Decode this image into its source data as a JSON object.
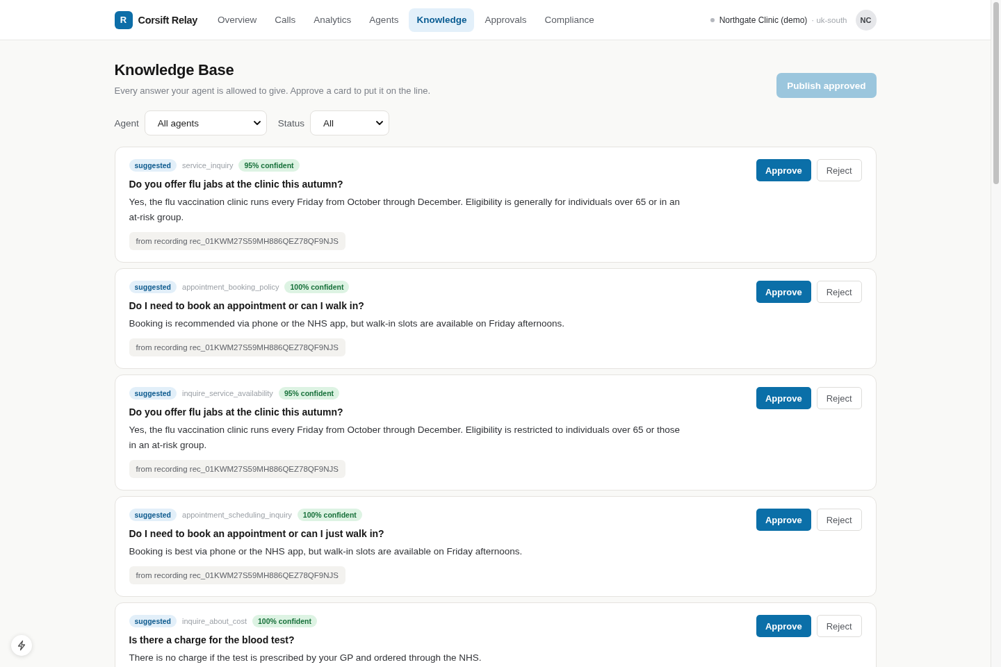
{
  "app": {
    "logo_letter": "R",
    "brand": "Corsift Relay"
  },
  "nav": [
    {
      "label": "Overview",
      "selected": false
    },
    {
      "label": "Calls",
      "selected": false
    },
    {
      "label": "Analytics",
      "selected": false
    },
    {
      "label": "Agents",
      "selected": false
    },
    {
      "label": "Knowledge",
      "selected": true
    },
    {
      "label": "Approvals",
      "selected": false
    },
    {
      "label": "Compliance",
      "selected": false
    }
  ],
  "account": {
    "workspace": "Northgate Clinic (demo)",
    "region": "· uk-south",
    "initials": "NC"
  },
  "page": {
    "title": "Knowledge Base",
    "subtitle": "Every answer your agent is allowed to give. Approve a card to put it on the line.",
    "publish_button": {
      "label": "Publish approved",
      "disabled": true
    }
  },
  "filters": [
    {
      "label": "Agent",
      "value": "All agents"
    },
    {
      "label": "Status",
      "value": "All"
    }
  ],
  "cards": [
    {
      "status": "suggested",
      "intent": "service_inquiry",
      "confidence": "95% confident",
      "question": "Do you offer flu jabs at the clinic this autumn?",
      "answer": "Yes, the flu vaccination clinic runs every Friday from October through December. Eligibility is generally for individuals over 65 or in an at-risk group.",
      "source": "from recording rec_01KWM27S59MH886QEZ78QF9NJS",
      "approve": "Approve",
      "reject": "Reject"
    },
    {
      "status": "suggested",
      "intent": "appointment_booking_policy",
      "confidence": "100% confident",
      "question": "Do I need to book an appointment or can I walk in?",
      "answer": "Booking is recommended via phone or the NHS app, but walk-in slots are available on Friday afternoons.",
      "source": "from recording rec_01KWM27S59MH886QEZ78QF9NJS",
      "approve": "Approve",
      "reject": "Reject"
    },
    {
      "status": "suggested",
      "intent": "inquire_service_availability",
      "confidence": "95% confident",
      "question": "Do you offer flu jabs at the clinic this autumn?",
      "answer": "Yes, the flu vaccination clinic runs every Friday from October through December. Eligibility is restricted to individuals over 65 or those in an at-risk group.",
      "source": "from recording rec_01KWM27S59MH886QEZ78QF9NJS",
      "approve": "Approve",
      "reject": "Reject"
    },
    {
      "status": "suggested",
      "intent": "appointment_scheduling_inquiry",
      "confidence": "100% confident",
      "question": "Do I need to book an appointment or can I just walk in?",
      "answer": "Booking is best via phone or the NHS app, but walk-in slots are available on Friday afternoons.",
      "source": "from recording rec_01KWM27S59MH886QEZ78QF9NJS",
      "approve": "Approve",
      "reject": "Reject"
    },
    {
      "status": "suggested",
      "intent": "inquire_about_cost",
      "confidence": "100% confident",
      "question": "Is there a charge for the blood test?",
      "answer": "There is no charge if the test is prescribed by your GP and ordered through the NHS.",
      "approve": "Approve",
      "reject": "Reject"
    }
  ]
}
